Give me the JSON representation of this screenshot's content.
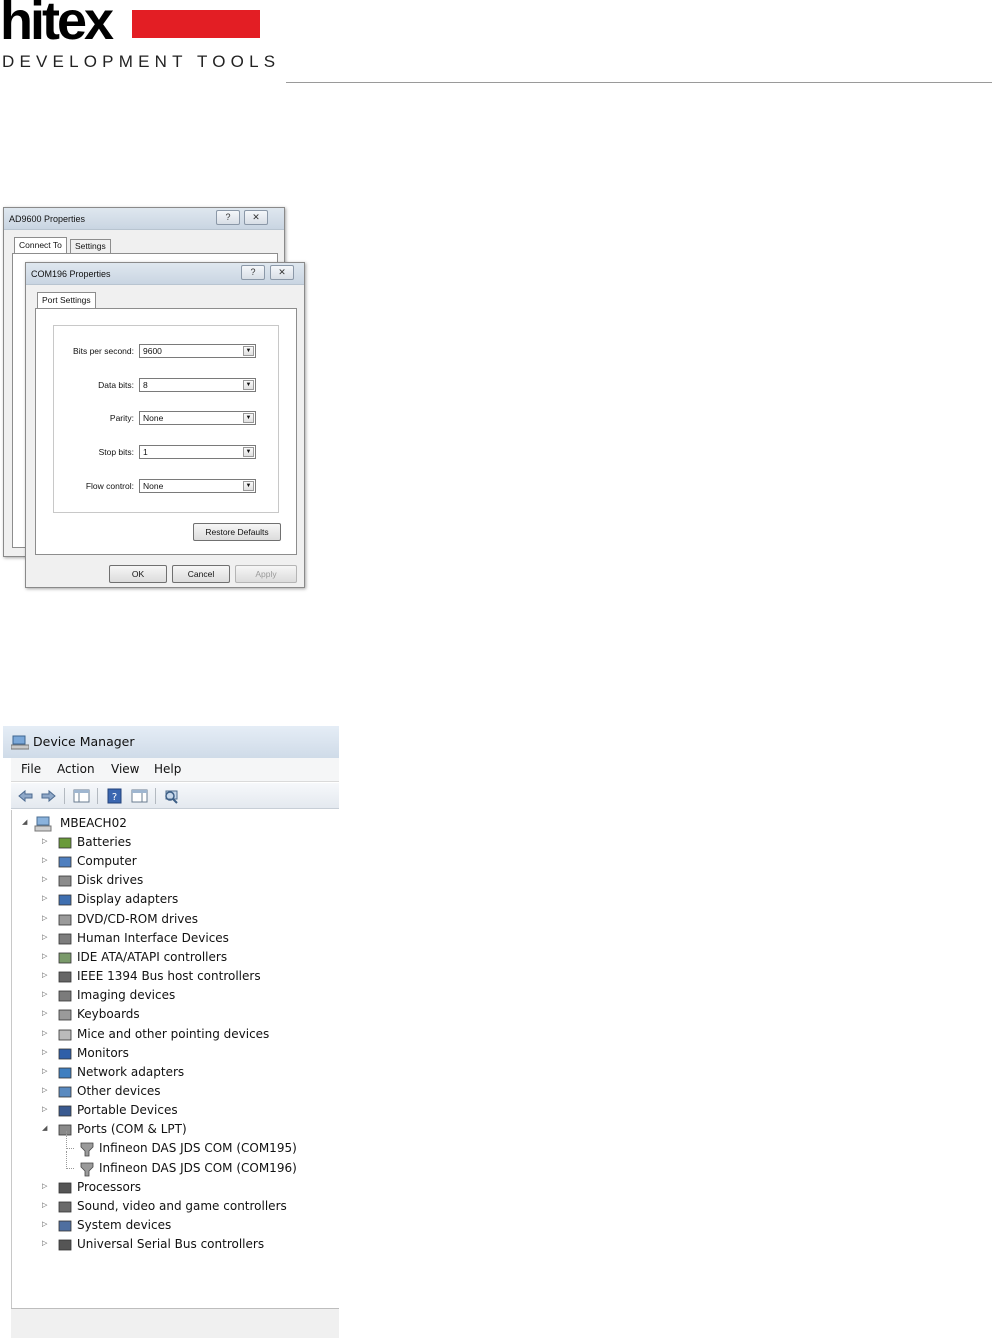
{
  "logo": {
    "wordmark": "hitex",
    "subtitle": "DEVELOPMENT TOOLS"
  },
  "dialog_back": {
    "title": "AD9600 Properties",
    "tabs": [
      "Connect To",
      "Settings"
    ]
  },
  "dialog_front": {
    "title": "COM196 Properties",
    "tab": "Port Settings",
    "fields": [
      {
        "label": "Bits per second:",
        "value": "9600"
      },
      {
        "label": "Data bits:",
        "value": "8"
      },
      {
        "label": "Parity:",
        "value": "None"
      },
      {
        "label": "Stop bits:",
        "value": "1"
      },
      {
        "label": "Flow control:",
        "value": "None"
      }
    ],
    "restore_label": "Restore Defaults",
    "ok_label": "OK",
    "cancel_label": "Cancel",
    "apply_label": "Apply"
  },
  "device_manager": {
    "title": "Device Manager",
    "menu": [
      "File",
      "Action",
      "View",
      "Help"
    ],
    "root": "MBEACH02",
    "categories": [
      {
        "label": "Batteries",
        "icon": "battery-icon"
      },
      {
        "label": "Computer",
        "icon": "computer-icon"
      },
      {
        "label": "Disk drives",
        "icon": "disk-drive-icon"
      },
      {
        "label": "Display adapters",
        "icon": "display-adapter-icon"
      },
      {
        "label": "DVD/CD-ROM drives",
        "icon": "dvd-drive-icon"
      },
      {
        "label": "Human Interface Devices",
        "icon": "hid-icon"
      },
      {
        "label": "IDE ATA/ATAPI controllers",
        "icon": "ide-controller-icon"
      },
      {
        "label": "IEEE 1394 Bus host controllers",
        "icon": "ieee1394-icon"
      },
      {
        "label": "Imaging devices",
        "icon": "camera-icon"
      },
      {
        "label": "Keyboards",
        "icon": "keyboard-icon"
      },
      {
        "label": "Mice and other pointing devices",
        "icon": "mouse-icon"
      },
      {
        "label": "Monitors",
        "icon": "monitor-icon"
      },
      {
        "label": "Network adapters",
        "icon": "network-icon"
      },
      {
        "label": "Other devices",
        "icon": "unknown-device-icon"
      },
      {
        "label": "Portable Devices",
        "icon": "portable-device-icon"
      },
      {
        "label": "Ports (COM & LPT)",
        "icon": "port-icon",
        "expanded": true,
        "children": [
          "Infineon DAS JDS COM  (COM195)",
          "Infineon DAS JDS COM  (COM196)"
        ]
      },
      {
        "label": "Processors",
        "icon": "processor-icon"
      },
      {
        "label": "Sound, video and game controllers",
        "icon": "speaker-icon"
      },
      {
        "label": "System devices",
        "icon": "system-device-icon"
      },
      {
        "label": "Universal Serial Bus controllers",
        "icon": "usb-icon"
      }
    ]
  },
  "colors": {
    "brand_red": "#e31e24",
    "titlebar": "#cfdbe8"
  }
}
